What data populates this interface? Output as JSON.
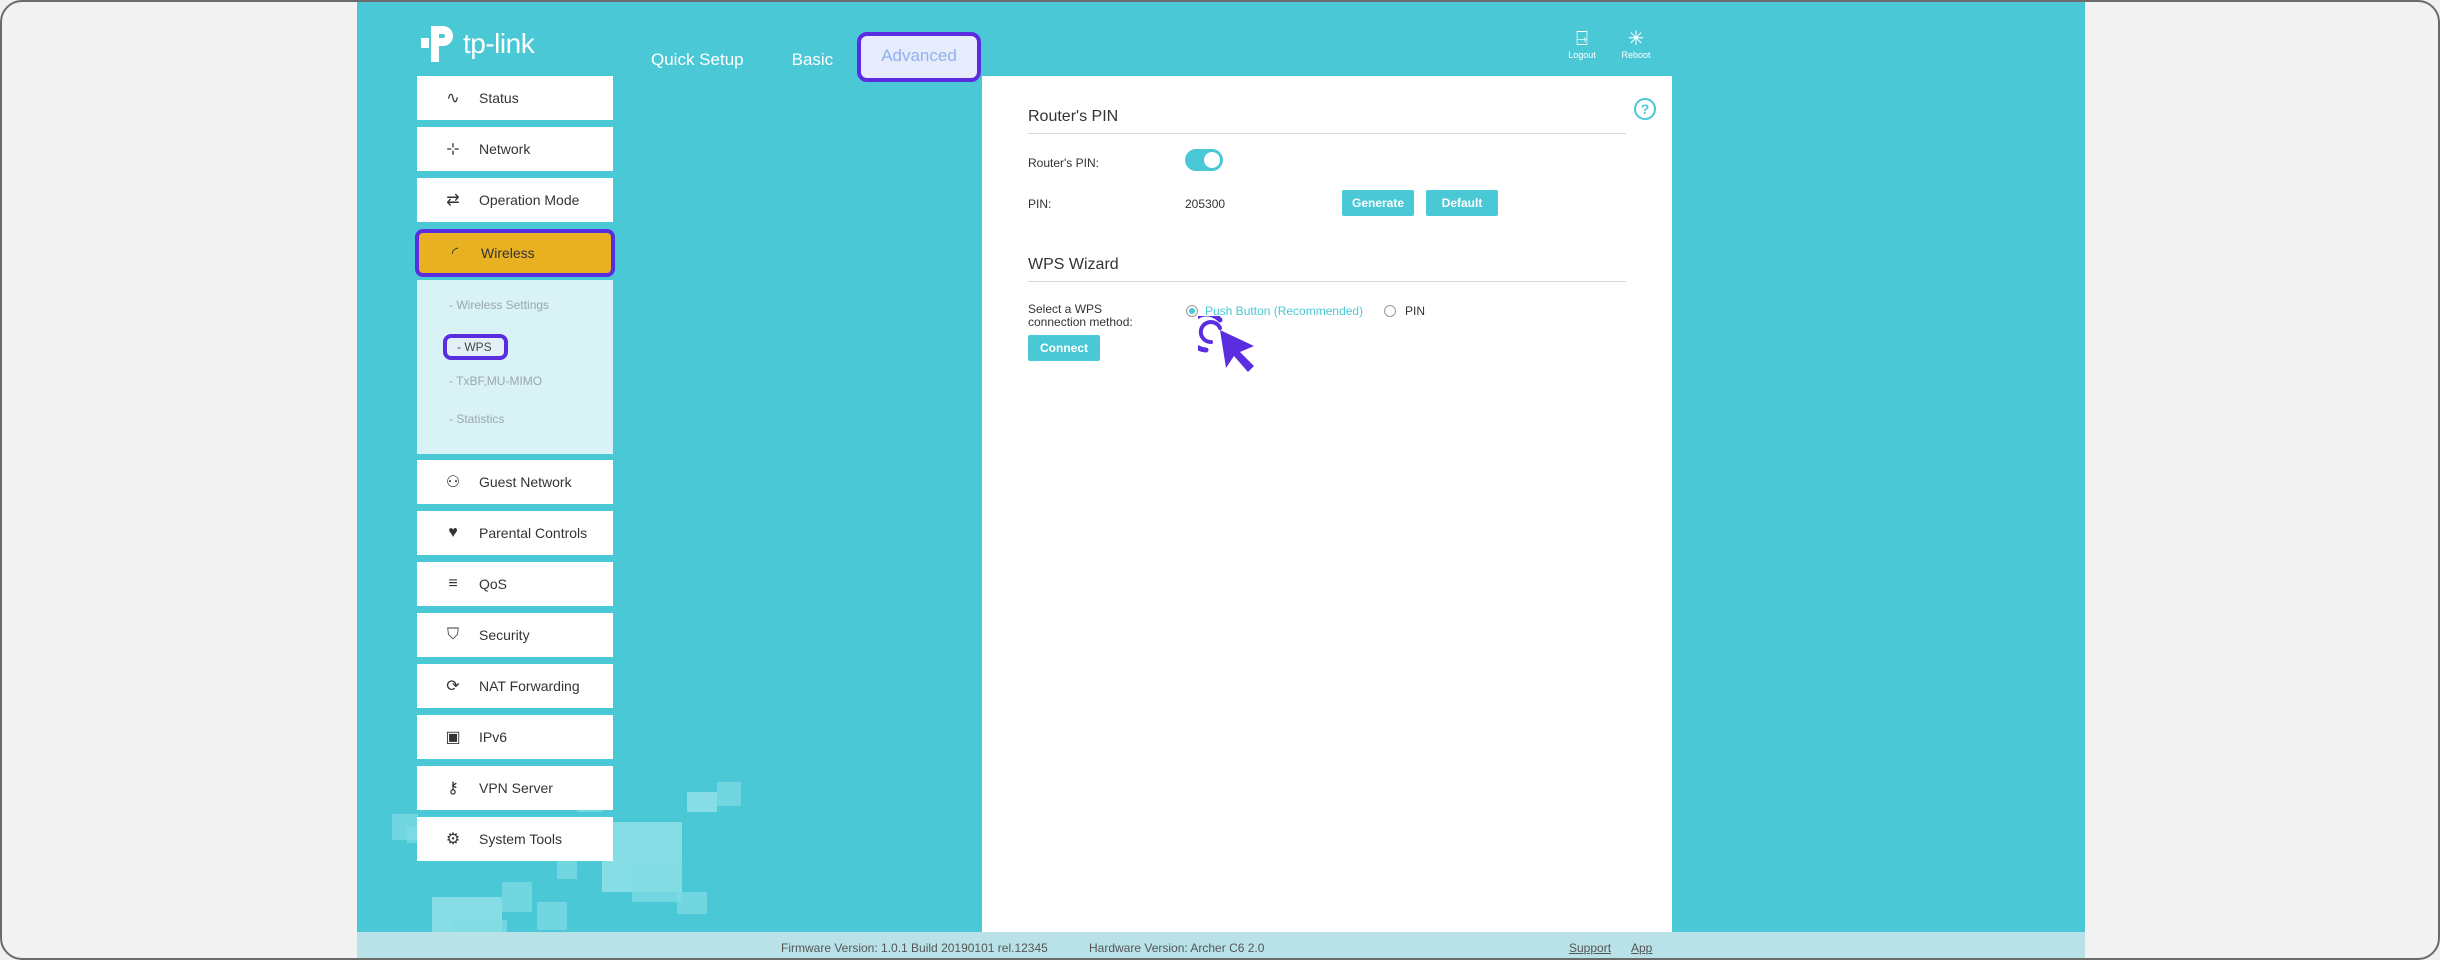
{
  "brand": {
    "logo_text": "tp-link"
  },
  "top_nav": {
    "tabs": [
      {
        "label": "Quick Setup",
        "active": false
      },
      {
        "label": "Basic",
        "active": false
      },
      {
        "label": "Advanced",
        "active": true
      }
    ],
    "logout_label": "Logout",
    "reboot_label": "Reboot"
  },
  "sidebar": {
    "items": [
      {
        "label": "Status",
        "icon": "pulse-icon"
      },
      {
        "label": "Network",
        "icon": "network-icon"
      },
      {
        "label": "Operation Mode",
        "icon": "loop-icon"
      },
      {
        "label": "Wireless",
        "icon": "wireless-icon",
        "active": true
      },
      {
        "label": "Guest Network",
        "icon": "users-icon"
      },
      {
        "label": "Parental Controls",
        "icon": "parental-icon"
      },
      {
        "label": "QoS",
        "icon": "qos-icon"
      },
      {
        "label": "Security",
        "icon": "shield-icon"
      },
      {
        "label": "NAT Forwarding",
        "icon": "nat-icon"
      },
      {
        "label": "IPv6",
        "icon": "ipv6-icon"
      },
      {
        "label": "VPN Server",
        "icon": "key-icon"
      },
      {
        "label": "System Tools",
        "icon": "gear-icon"
      }
    ],
    "sub_items": [
      {
        "label": "Wireless Settings"
      },
      {
        "label": "WPS",
        "active": true
      },
      {
        "label": "TxBF,MU-MIMO"
      },
      {
        "label": "Statistics"
      }
    ]
  },
  "routers_pin": {
    "title": "Router's PIN",
    "pin_toggle_label": "Router's PIN:",
    "pin_toggle_on": true,
    "pin_label": "PIN:",
    "pin_value": "205300",
    "generate_label": "Generate",
    "default_label": "Default"
  },
  "wps_wizard": {
    "title": "WPS Wizard",
    "method_label": "Select a WPS connection method:",
    "options": [
      {
        "label": "Push Button (Recommended)",
        "selected": true
      },
      {
        "label": "PIN",
        "selected": false
      }
    ],
    "connect_label": "Connect"
  },
  "footer": {
    "firmware": "Firmware Version: 1.0.1 Build 20190101 rel.12345",
    "hardware": "Hardware Version: Archer C6 2.0",
    "support_label": "Support",
    "app_label": "App"
  },
  "colors": {
    "teal": "#4ac8d6",
    "active_nav": "#e7b122",
    "highlight": "#5a2ee0"
  }
}
